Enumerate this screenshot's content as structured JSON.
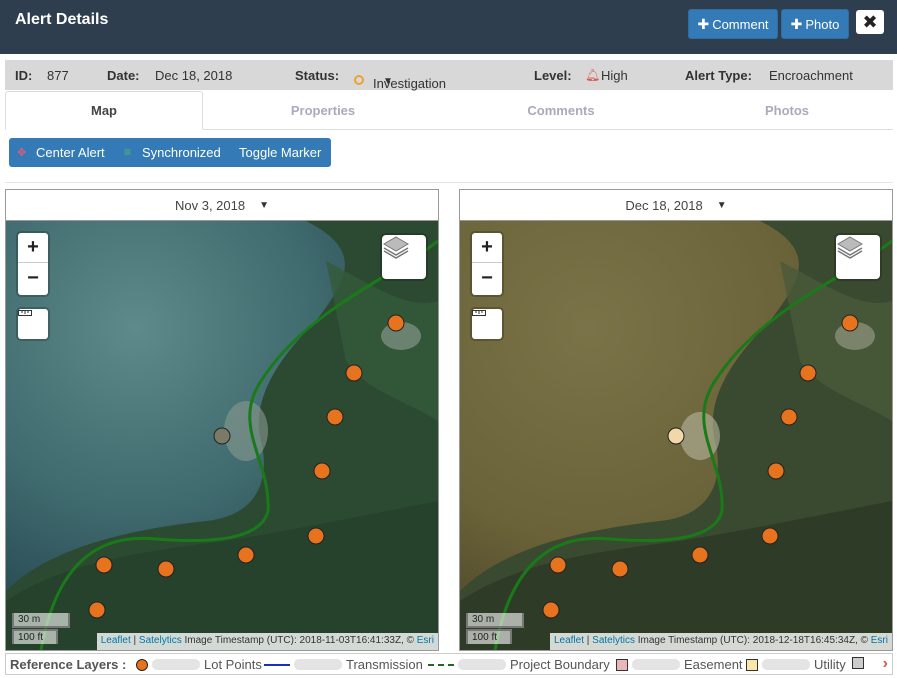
{
  "header": {
    "title": "Alert Details",
    "comment_button": "Comment",
    "photo_button": "Photo",
    "close_icon": "close-icon"
  },
  "info": {
    "id_label": "ID:",
    "id_value": "877",
    "date_label": "Date:",
    "date_value": "Dec 18, 2018",
    "status_label": "Status:",
    "status_value": "Investigation",
    "status_color": "#f0a030",
    "level_label": "Level:",
    "level_value": "High",
    "level_color": "#d9534f",
    "type_label": "Alert Type:",
    "type_value": "Encroachment"
  },
  "tabs": [
    {
      "label": "Map",
      "active": true
    },
    {
      "label": "Properties",
      "active": false
    },
    {
      "label": "Comments",
      "active": false
    },
    {
      "label": "Photos",
      "active": false
    }
  ],
  "toolbar": {
    "center_alert": "Center Alert",
    "synchronized": "Synchronized",
    "toggle_marker": "Toggle Marker"
  },
  "maps": [
    {
      "date": "Nov 3, 2018",
      "scale_m": "30 m",
      "scale_ft": "100 ft",
      "attribution_leaflet": "Leaflet",
      "attribution_satelytics": "Satelytics",
      "attribution_text": "Image Timestamp (UTC): 2018-11-03T16:41:33Z, ©",
      "attribution_esri": "Esri"
    },
    {
      "date": "Dec 18, 2018",
      "scale_m": "30 m",
      "scale_ft": "100 ft",
      "attribution_leaflet": "Leaflet",
      "attribution_satelytics": "Satelytics",
      "attribution_text": "Image Timestamp (UTC): 2018-12-18T16:45:34Z, ©",
      "attribution_esri": "Esri"
    }
  ],
  "reference_layers": {
    "title": "Reference Layers :",
    "items": [
      {
        "label": "Lot Points",
        "symbol": "dot",
        "color": "#e8731e"
      },
      {
        "label": "Transmission",
        "symbol": "line",
        "color": "#1b2fbf"
      },
      {
        "label": "Project Boundary",
        "symbol": "dash",
        "color": "#1e6b1e"
      },
      {
        "label": "Easement",
        "symbol": "square",
        "color": "#e8b8b8"
      },
      {
        "label": "Utility",
        "symbol": "square",
        "color": "#f7e6a8"
      }
    ]
  },
  "colors": {
    "header_bg": "#2f3e4f",
    "primary_button": "#337ab7",
    "lot_point": "#e8731e",
    "boundary": "#1e7a1e"
  }
}
